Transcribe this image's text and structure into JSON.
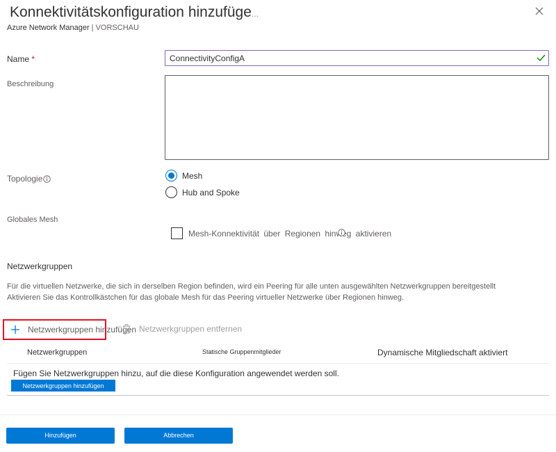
{
  "header": {
    "title": "Konnektivitätskonfiguration hinzufüge",
    "overflow_glyph": "...",
    "app_name": "Azure Network Manager",
    "separator": "|",
    "preview": "VORSCHAU",
    "close_icon": "close-icon"
  },
  "form": {
    "name": {
      "label": "Name",
      "required_marker": "*",
      "value": "ConnectivityConfigA"
    },
    "description": {
      "label": "Beschreibung",
      "value": ""
    },
    "topology": {
      "label": "Topologie",
      "options": [
        {
          "label": "Mesh",
          "selected": true
        },
        {
          "label": "Hub and Spoke",
          "selected": false
        }
      ]
    },
    "global_mesh": {
      "label": "Globales Mesh",
      "checkbox_label": "Mesh-Konnektivität über Regionen hinweg aktivieren",
      "checked": false
    }
  },
  "network_groups": {
    "heading": "Netzwerkgruppen",
    "description_lines": [
      "Für die virtuellen Netzwerke, die sich in derselben Region befinden, wird ein Peering für alle unten ausgewählten Netzwerkgruppen bereitgestellt",
      "Aktivieren Sie das Kontrollkästchen für das globale Mesh für das Peering virtueller Netzwerke über Regionen hinweg."
    ],
    "add_label": "Netzwerkgruppen hinzufügen",
    "remove_label": "Netzwerkgruppen entfernen",
    "columns": [
      "Netzwerkgruppen",
      "Statische Gruppenmitglieder",
      "Dynamische Mitgliedschaft aktiviert"
    ],
    "empty_message": "Fügen Sie Netzwerkgruppen hinzu, auf die diese Konfiguration angewendet werden soll.",
    "empty_add_button": "Netzwerkgruppen hinzufügen"
  },
  "footer": {
    "add_button": "Hinzufügen",
    "cancel_button": "Abbrechen"
  },
  "colors": {
    "accent": "#0078d4",
    "focus_border": "#8764b8",
    "highlight_box": "#e81123",
    "required": "#a4262c"
  }
}
